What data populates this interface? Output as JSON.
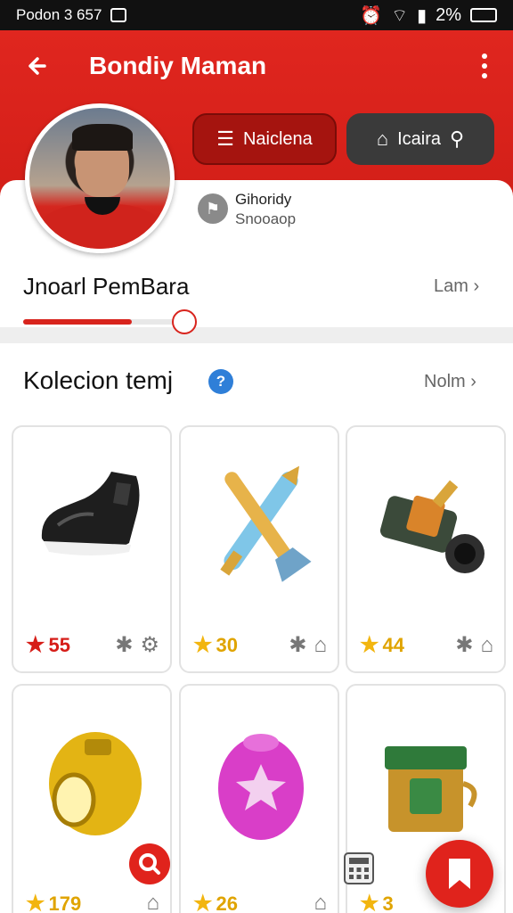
{
  "status": {
    "time": "Podon 3 657",
    "battery": "2%"
  },
  "header": {
    "title": "Bondiy Maman"
  },
  "buttons": {
    "primary": "Naiclena",
    "secondary": "Icaira"
  },
  "role": {
    "name": "Gihoridy",
    "subtitle": "Snooaop"
  },
  "section1": {
    "title": "Jnoarl PemBara",
    "link": "Lam"
  },
  "section2": {
    "title": "Kolecion temj",
    "link": "Nolm"
  },
  "progress": {
    "value": 0.68
  },
  "items": [
    {
      "rating": "55",
      "rating_color": "red"
    },
    {
      "rating": "30",
      "rating_color": "gold"
    },
    {
      "rating": "44",
      "rating_color": "gold"
    },
    {
      "rating": "179",
      "rating_color": "gold"
    },
    {
      "rating": "26",
      "rating_color": "gold"
    },
    {
      "rating": "3",
      "rating_color": "gold"
    }
  ],
  "colors": {
    "accent": "#e0231c",
    "dark_button": "#3a3a3a",
    "help": "#2f7fd8",
    "star": "#f2b50f"
  }
}
